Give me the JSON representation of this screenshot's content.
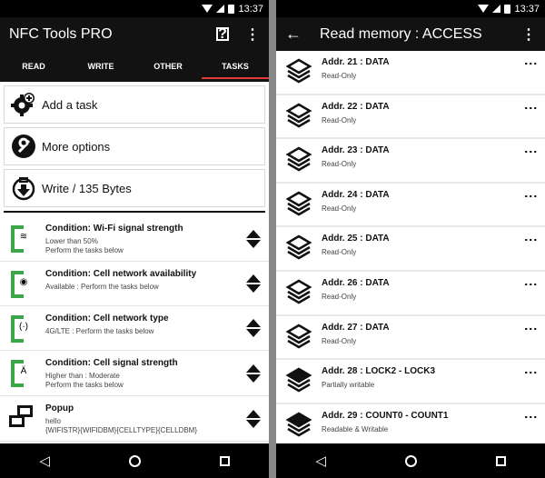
{
  "status_bar": {
    "time": "13:37"
  },
  "left": {
    "app_title": "NFC Tools PRO",
    "help_icon_label": "?",
    "tabs": [
      {
        "label": "READ",
        "active": false
      },
      {
        "label": "WRITE",
        "active": false
      },
      {
        "label": "OTHER",
        "active": false
      },
      {
        "label": "TASKS",
        "active": true
      }
    ],
    "actions": [
      {
        "label": "Add a task",
        "icon": "gear-plus-icon"
      },
      {
        "label": "More options",
        "icon": "wrench-icon"
      },
      {
        "label": "Write / 135 Bytes",
        "icon": "download-write-icon"
      }
    ],
    "tasks": [
      {
        "title": "Condition: Wi-Fi signal strength",
        "lines": [
          "Lower than 50%",
          "Perform the tasks below"
        ],
        "icon": "wifi-icon",
        "glyph": "≋"
      },
      {
        "title": "Condition: Cell network availability",
        "lines": [
          "Available : Perform the tasks below"
        ],
        "icon": "cell-network-icon",
        "glyph": "◉"
      },
      {
        "title": "Condition: Cell network type",
        "lines": [
          "4G/LTE : Perform the tasks below"
        ],
        "icon": "cell-type-icon",
        "glyph": "(·)"
      },
      {
        "title": "Condition: Cell signal strength",
        "lines": [
          "Higher than : Moderate",
          "Perform the tasks below"
        ],
        "icon": "antenna-icon",
        "glyph": "Ä"
      },
      {
        "title": "Popup",
        "lines": [
          "hello",
          "{WIFISTR}{WIFIDBM}{CELLTYPE}{CELLDBM}"
        ],
        "icon": "popup-icon",
        "glyph": ""
      }
    ]
  },
  "right": {
    "title": "Read memory : ACCESS",
    "items": [
      {
        "title": "Addr. 21 : DATA",
        "subtitle": "Read-Only",
        "filled": false
      },
      {
        "title": "Addr. 22 : DATA",
        "subtitle": "Read-Only",
        "filled": false
      },
      {
        "title": "Addr. 23 : DATA",
        "subtitle": "Read-Only",
        "filled": false
      },
      {
        "title": "Addr. 24 : DATA",
        "subtitle": "Read-Only",
        "filled": false
      },
      {
        "title": "Addr. 25 : DATA",
        "subtitle": "Read-Only",
        "filled": false
      },
      {
        "title": "Addr. 26 : DATA",
        "subtitle": "Read-Only",
        "filled": false
      },
      {
        "title": "Addr. 27 : DATA",
        "subtitle": "Read-Only",
        "filled": false
      },
      {
        "title": "Addr. 28 : LOCK2 - LOCK3",
        "subtitle": "Partially writable",
        "filled": true
      },
      {
        "title": "Addr. 29 : COUNT0 - COUNT1",
        "subtitle": "Readable & Writable",
        "filled": true
      }
    ]
  },
  "nav": {
    "back": "◁"
  },
  "colors": {
    "accent": "#e53935",
    "condition": "#3aa84a",
    "appbar": "#121212"
  }
}
